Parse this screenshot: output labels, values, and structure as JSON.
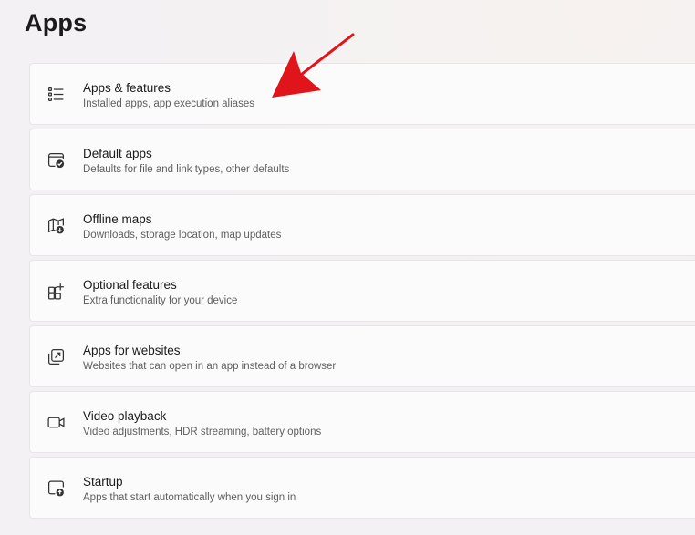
{
  "page": {
    "title": "Apps"
  },
  "items": [
    {
      "label": "Apps & features",
      "description": "Installed apps, app execution aliases",
      "icon": "apps-list-icon"
    },
    {
      "label": "Default apps",
      "description": "Defaults for file and link types, other defaults",
      "icon": "default-apps-icon"
    },
    {
      "label": "Offline maps",
      "description": "Downloads, storage location, map updates",
      "icon": "offline-map-icon"
    },
    {
      "label": "Optional features",
      "description": "Extra functionality for your device",
      "icon": "optional-features-icon"
    },
    {
      "label": "Apps for websites",
      "description": "Websites that can open in an app instead of a browser",
      "icon": "open-in-app-icon"
    },
    {
      "label": "Video playback",
      "description": "Video adjustments, HDR streaming, battery options",
      "icon": "video-camera-icon"
    },
    {
      "label": "Startup",
      "description": "Apps that start automatically when you sign in",
      "icon": "startup-icon"
    }
  ],
  "colors": {
    "background": "#f3f1f3",
    "card": "#fbfbfb",
    "card_border": "#e7e5e7",
    "annotation_arrow": "#e0141b"
  }
}
